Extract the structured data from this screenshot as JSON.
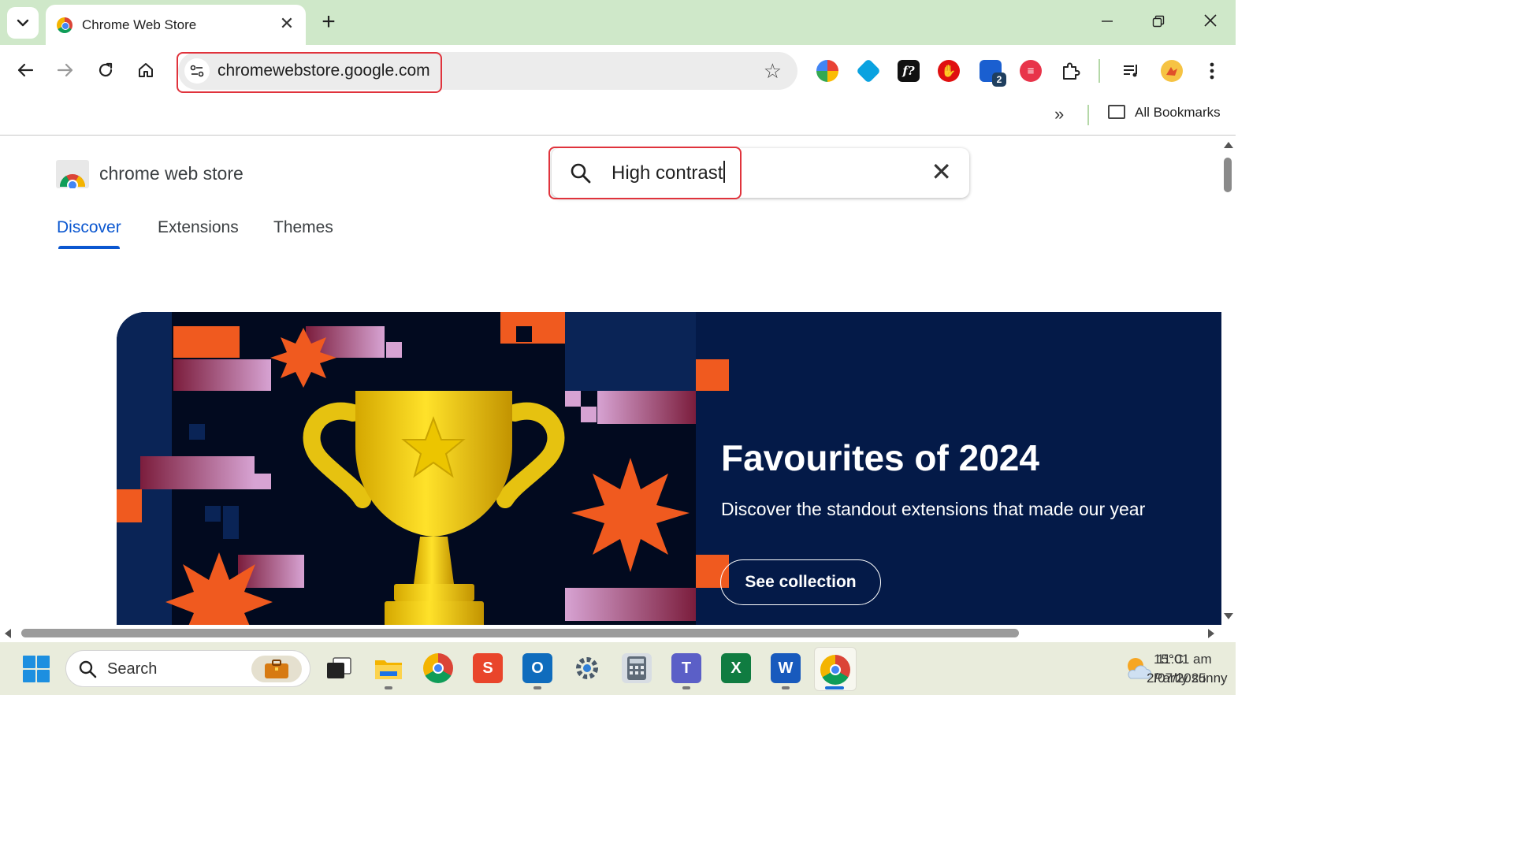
{
  "browser": {
    "tab_title": "Chrome Web Store",
    "new_tab_symbol": "+",
    "url": "chromewebstore.google.com",
    "extension_badge": "2",
    "bookmarks_label": "All Bookmarks"
  },
  "store": {
    "name": "chrome web store",
    "search_value": "High contrast",
    "tabs": [
      {
        "label": "Discover",
        "active": true
      },
      {
        "label": "Extensions",
        "active": false
      },
      {
        "label": "Themes",
        "active": false
      }
    ],
    "hero": {
      "title": "Favourites of 2024",
      "subtitle": "Discover the standout extensions that made our year",
      "button": "See collection"
    }
  },
  "taskbar": {
    "search_label": "Search",
    "temperature": "15°C",
    "time": "11:01 am",
    "weather": "Partly sunny",
    "date": "2/07/2025"
  },
  "colors": {
    "tabstrip": "#cfe8c9",
    "highlight_box": "#e0333c",
    "accent_blue": "#0b57d0",
    "hero_bg": "#041a48",
    "hero_orange": "#f05a1f",
    "trophy_gold": "#f3cf1b"
  },
  "icons": [
    "tab-search-icon",
    "back-icon",
    "forward-icon",
    "reload-icon",
    "home-icon",
    "site-info-icon",
    "bookmark-star-icon",
    "extensions-puzzle-icon",
    "media-control-icon",
    "kebab-menu-icon",
    "folder-icon",
    "search-icon",
    "clear-icon",
    "windows-start-icon",
    "weather-icon"
  ]
}
